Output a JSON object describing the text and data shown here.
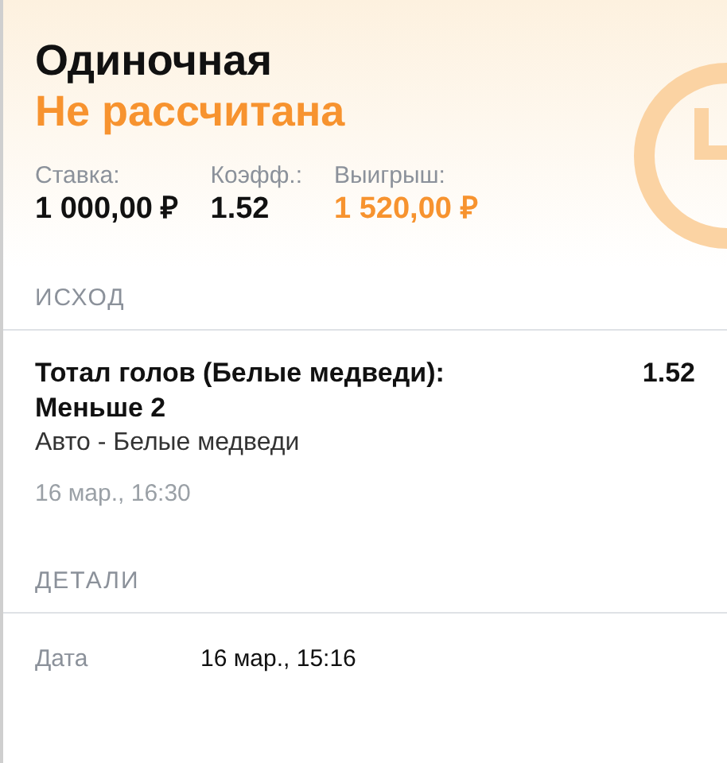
{
  "bet": {
    "type": "Одиночная",
    "status": "Не рассчитана",
    "stats": [
      {
        "label": "Ставка:",
        "value": "1 000,00 ₽",
        "highlight": false
      },
      {
        "label": "Коэфф.:",
        "value": "1.52",
        "highlight": false
      },
      {
        "label": "Выигрыш:",
        "value": "1 520,00 ₽",
        "highlight": true
      }
    ]
  },
  "outcome": {
    "heading": "ИСХОД",
    "title": "Тотал голов (Белые медведи): Меньше 2",
    "odds": "1.52",
    "event": "Авто - Белые медведи",
    "time": "16 мар., 16:30"
  },
  "details": {
    "heading": "ДЕТАЛИ",
    "rows": [
      {
        "label": "Дата",
        "value": "16 мар., 15:16"
      }
    ]
  }
}
